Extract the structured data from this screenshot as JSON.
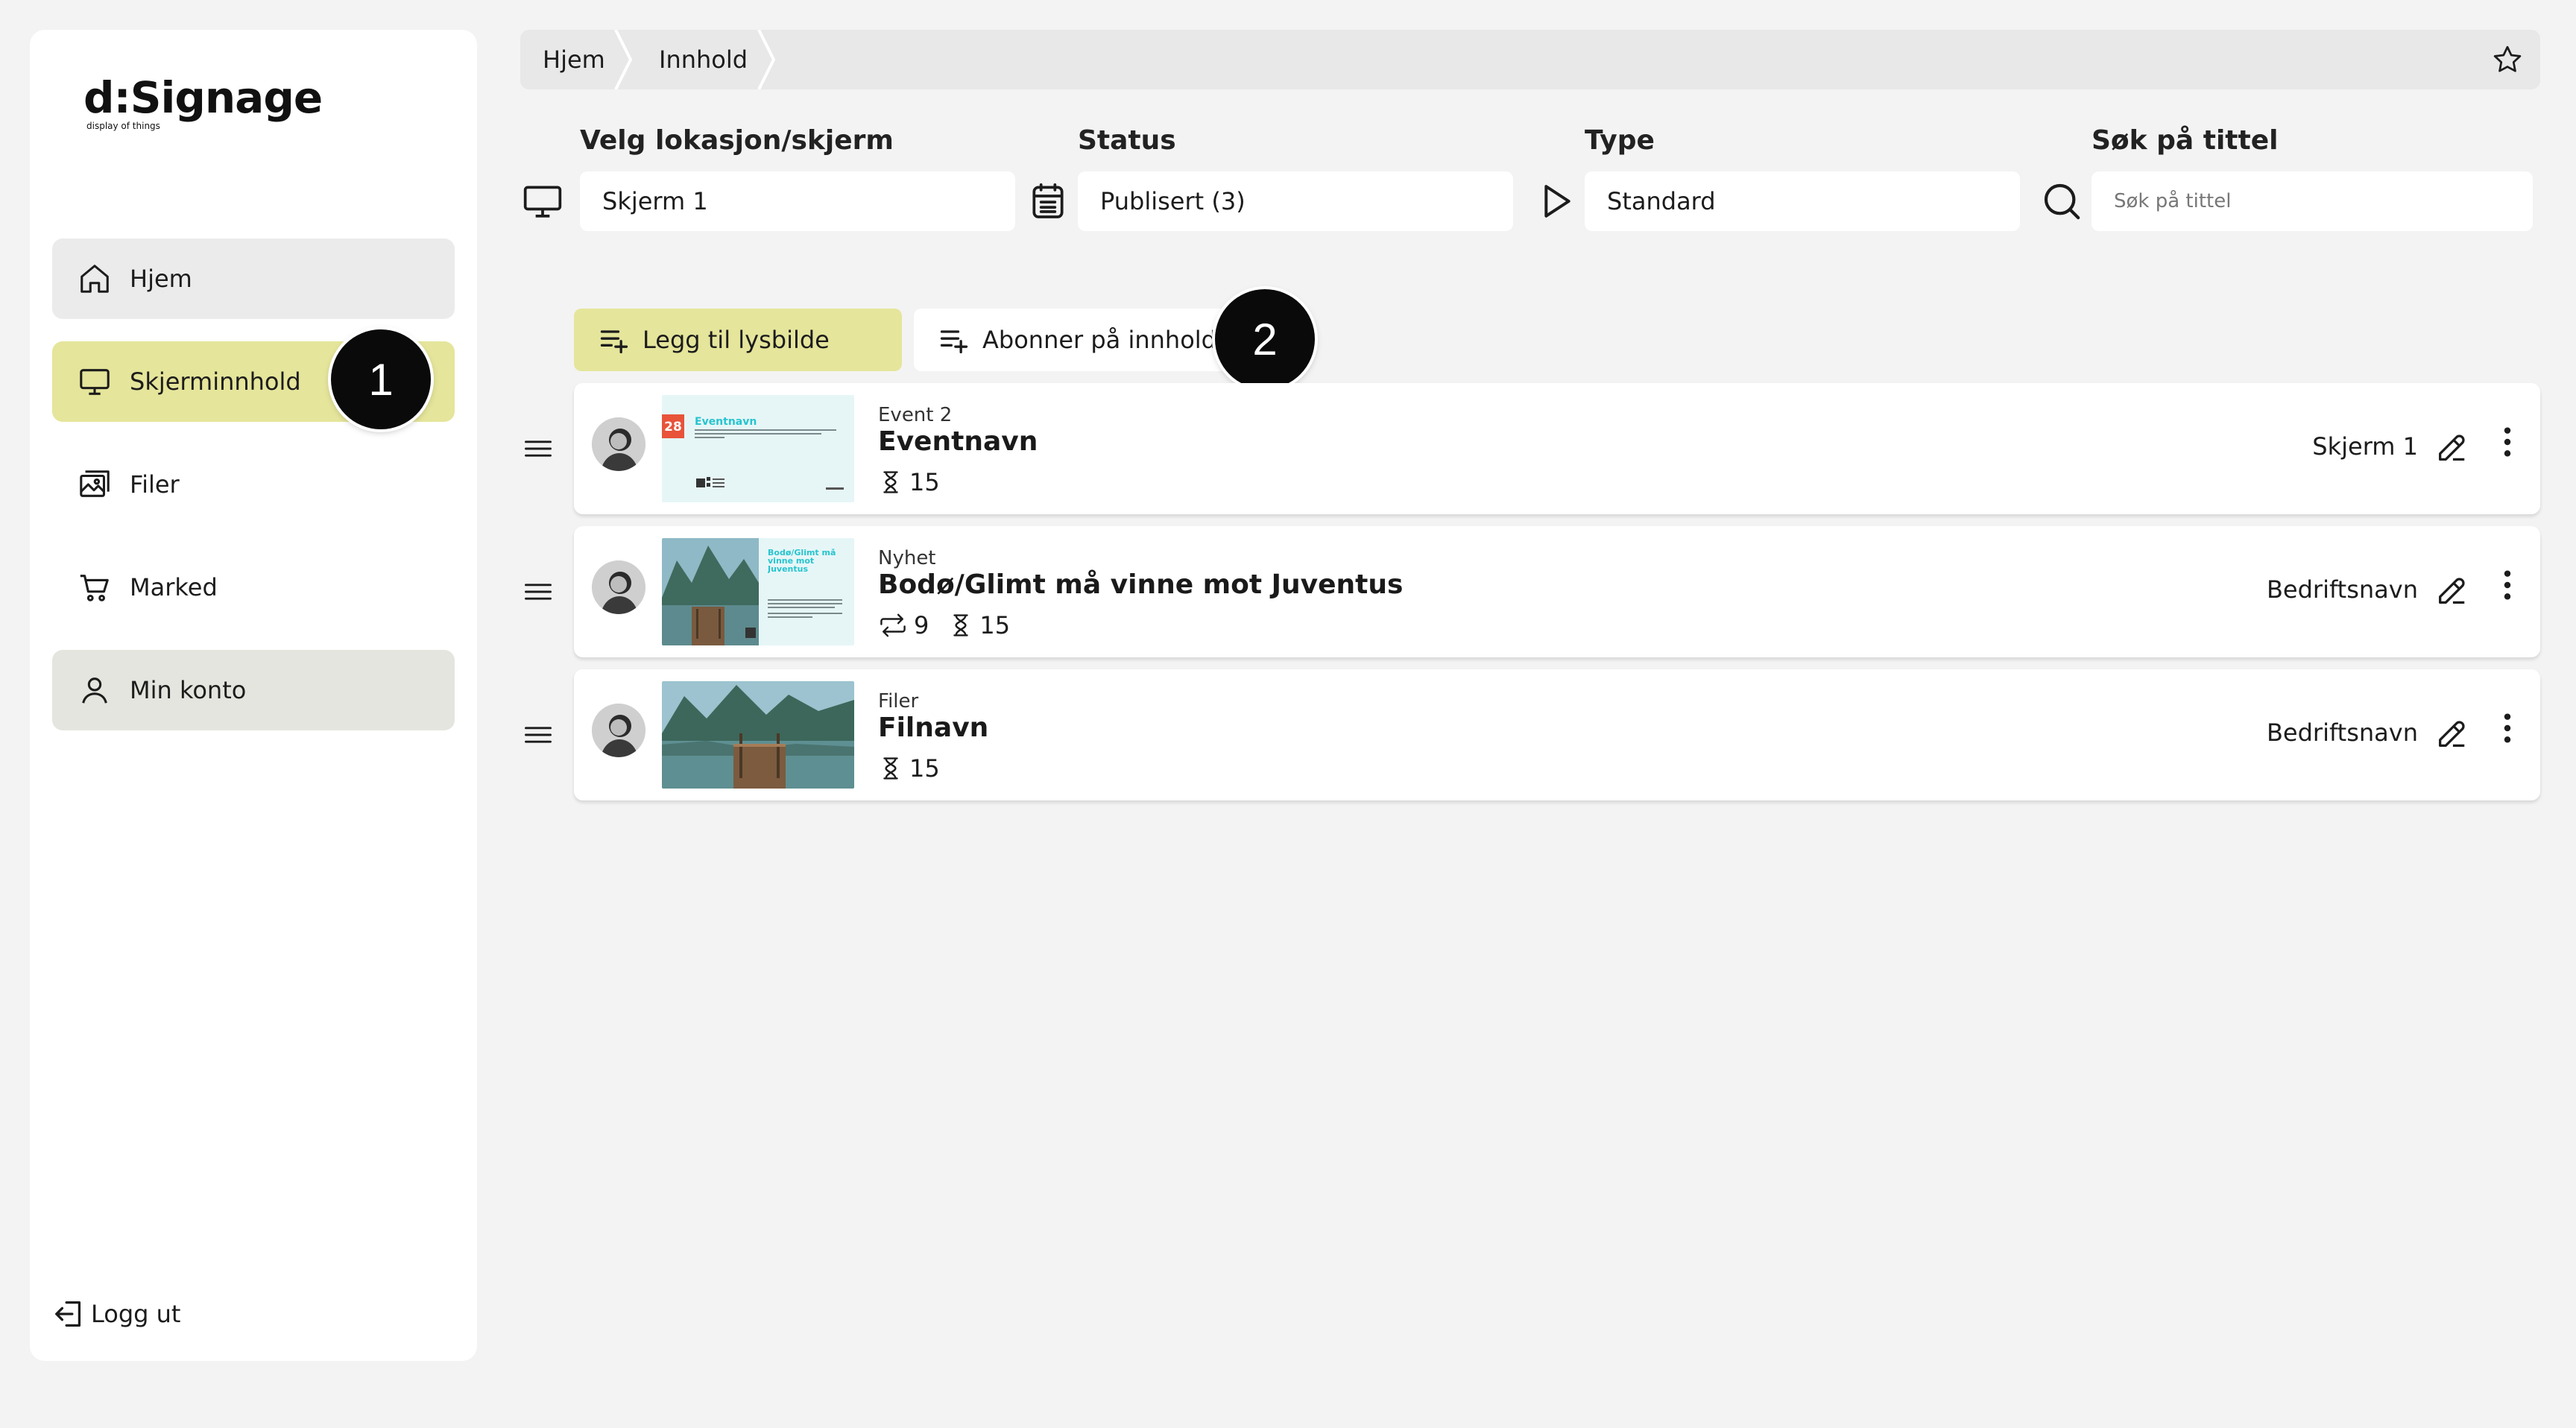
{
  "logo": {
    "main": "d:Signage",
    "sub": "display of things"
  },
  "sidebar": {
    "items": [
      {
        "label": "Hjem",
        "icon": "home-icon"
      },
      {
        "label": "Skjerminnhold",
        "icon": "monitor-icon"
      },
      {
        "label": "Filer",
        "icon": "images-icon"
      },
      {
        "label": "Marked",
        "icon": "cart-icon"
      },
      {
        "label": "Min konto",
        "icon": "user-icon"
      }
    ],
    "logout": "Logg ut"
  },
  "markers": {
    "one": "1",
    "two": "2"
  },
  "breadcrumb": {
    "items": [
      "Hjem",
      "Innhold"
    ]
  },
  "filters": {
    "location": {
      "label": "Velg lokasjon/skjerm",
      "value": "Skjerm 1"
    },
    "status": {
      "label": "Status",
      "value": "Publisert (3)"
    },
    "type": {
      "label": "Type",
      "value": "Standard"
    },
    "search": {
      "label": "Søk på tittel",
      "placeholder": "Søk på tittel"
    }
  },
  "actions": {
    "add_slide": "Legg til lysbilde",
    "subscribe": "Abonner på innholdstjeneste"
  },
  "rows": [
    {
      "type": "Event 2",
      "title": "Eventnavn",
      "duration": "15",
      "location": "Skjerm 1",
      "thumb": {
        "date": "28",
        "heading": "Eventnavn"
      }
    },
    {
      "type": "Nyhet",
      "title": "Bodø/Glimt må vinne mot Juventus",
      "repeat": "9",
      "duration": "15",
      "location": "Bedriftsnavn",
      "thumb": {
        "heading": "Bodø/Glimt må vinne mot Juventus"
      }
    },
    {
      "type": "Filer",
      "title": "Filnavn",
      "duration": "15",
      "location": "Bedriftsnavn"
    }
  ],
  "colors": {
    "accent": "#e5e59b",
    "background": "#f3f3f3",
    "thumb_teal": "#e6f6f7",
    "date_red": "#e8533a"
  }
}
